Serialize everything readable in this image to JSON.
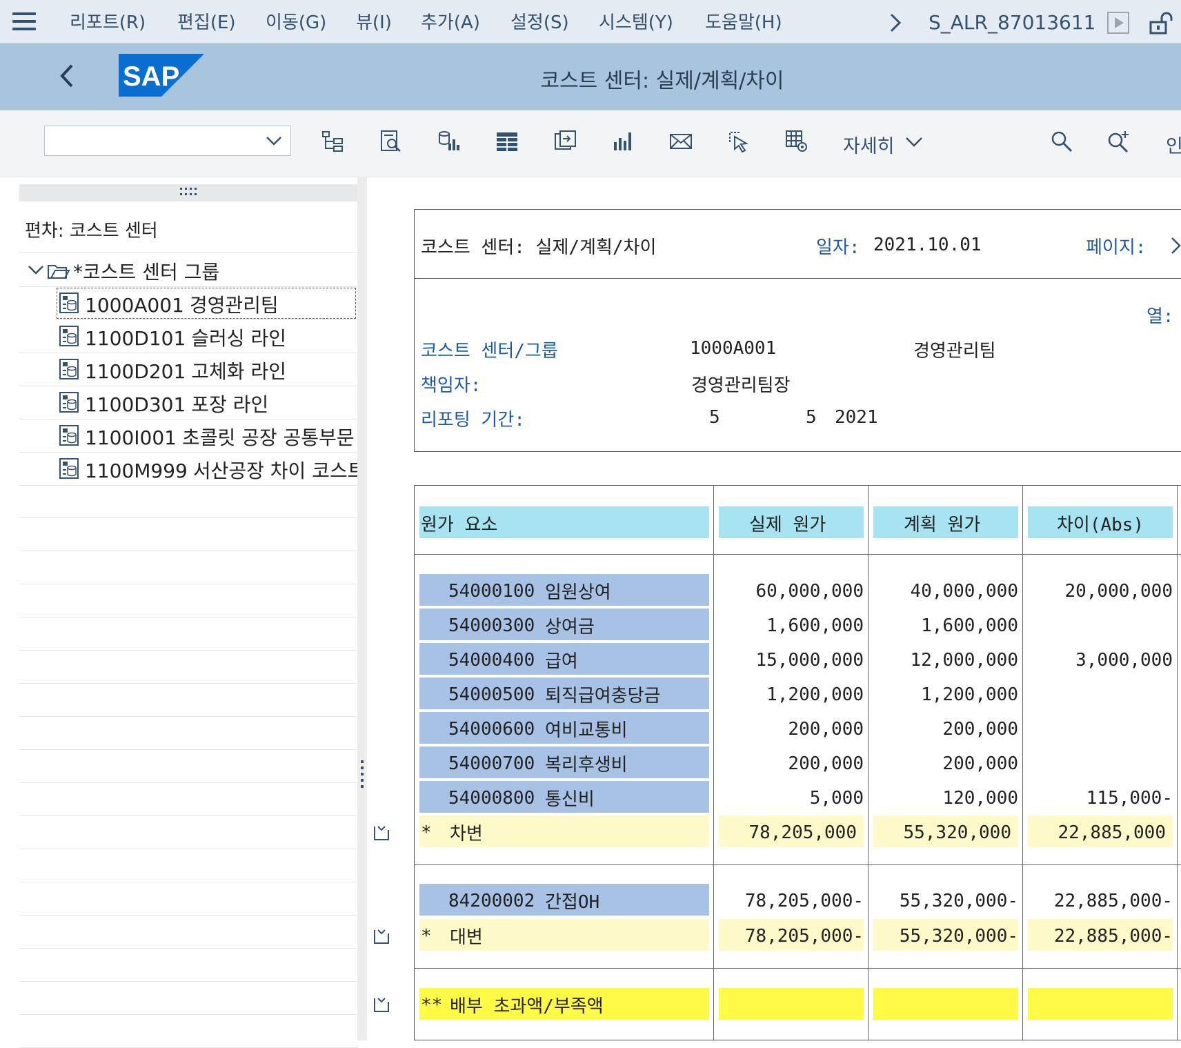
{
  "menu": {
    "items": [
      "리포트(R)",
      "편집(E)",
      "이동(G)",
      "뷰(I)",
      "추가(A)",
      "설정(S)",
      "시스템(Y)",
      "도움말(H)"
    ],
    "transaction": "S_ALR_87013611"
  },
  "titlebar": {
    "title": "코스트 센터: 실제/계획/차이",
    "logo_text": "SAP"
  },
  "toolbar": {
    "layout_value": "",
    "more_label": "자세히",
    "partial_label": "인"
  },
  "tree": {
    "heading": "편차: 코스트 센터",
    "root": "*코스트 센터 그룹",
    "items": [
      {
        "code": "1000A001",
        "name": "경영관리팀"
      },
      {
        "code": "1100D101",
        "name": "슬러싱 라인"
      },
      {
        "code": "1100D201",
        "name": "고체화 라인"
      },
      {
        "code": "1100D301",
        "name": "포장 라인"
      },
      {
        "code": "1100I001",
        "name": "초콜릿 공장 공통부문"
      },
      {
        "code": "1100M999",
        "name": "서산공장 차이 코스트센터"
      }
    ]
  },
  "report": {
    "title": "코스트 센터: 실제/계획/차이",
    "date_label": "일자:",
    "date_value": "2021.10.01",
    "page_label": "페이지:",
    "column_label": "열:",
    "cc_label": "코스트 센터/그룹",
    "cc_code": "1000A001",
    "cc_name": "경영관리팀",
    "resp_label": "책임자:",
    "resp_value": "경영관리팀장",
    "period_label": "리포팅 기간:",
    "period_from": "5",
    "period_to": "5",
    "period_year": "2021",
    "headers": {
      "element": "원가 요소",
      "actual": "실제 원가",
      "plan": "계획 원가",
      "var": "차이(Abs)"
    },
    "debit_rows": [
      {
        "code": "54000100",
        "name": "임원상여",
        "actual": "60,000,000",
        "plan": "40,000,000",
        "var": "20,000,000"
      },
      {
        "code": "54000300",
        "name": "상여금",
        "actual": "1,600,000",
        "plan": "1,600,000",
        "var": ""
      },
      {
        "code": "54000400",
        "name": "급여",
        "actual": "15,000,000",
        "plan": "12,000,000",
        "var": "3,000,000"
      },
      {
        "code": "54000500",
        "name": "퇴직급여충당금",
        "actual": "1,200,000",
        "plan": "1,200,000",
        "var": ""
      },
      {
        "code": "54000600",
        "name": "여비교통비",
        "actual": "200,000",
        "plan": "200,000",
        "var": ""
      },
      {
        "code": "54000700",
        "name": "복리후생비",
        "actual": "200,000",
        "plan": "200,000",
        "var": ""
      },
      {
        "code": "54000800",
        "name": "통신비",
        "actual": "5,000",
        "plan": "120,000",
        "var": "115,000-"
      }
    ],
    "debit_total": {
      "mark": "*",
      "name": "차변",
      "actual": "78,205,000",
      "plan": "55,320,000",
      "var": "22,885,000"
    },
    "credit_row": {
      "code": "84200002",
      "name": "간접OH",
      "actual": "78,205,000-",
      "plan": "55,320,000-",
      "var": "22,885,000-"
    },
    "credit_total": {
      "mark": "*",
      "name": "대변",
      "actual": "78,205,000-",
      "plan": "55,320,000-",
      "var": "22,885,000-"
    },
    "grand_total": {
      "mark": "**",
      "name": "배부 초과액/부족액"
    }
  },
  "colors": {
    "menu_bg": "#e4ebf2",
    "title_bg": "#a9c4dd",
    "header_cyan": "#a7e3f0",
    "row_blue": "#a8c2e6",
    "total_light": "#fdf9c8",
    "total_bright": "#fefa46",
    "label_blue": "#1f5aa6"
  }
}
